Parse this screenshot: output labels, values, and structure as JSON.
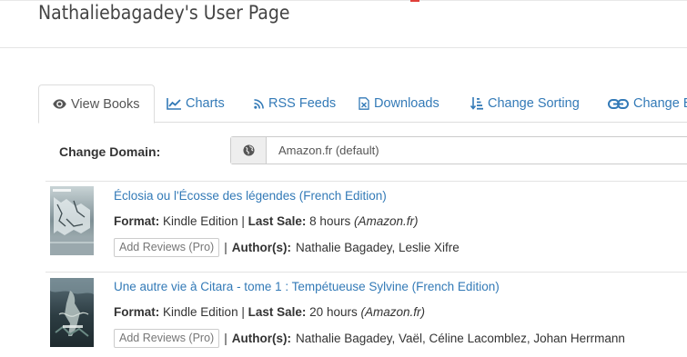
{
  "page": {
    "title": "Nathaliebagadey's User Page"
  },
  "tabs": [
    {
      "label": "View Books",
      "icon": "eye-icon",
      "active": true
    },
    {
      "label": "Charts",
      "icon": "line-chart-icon",
      "active": false
    },
    {
      "label": "RSS Feeds",
      "icon": "rss-icon",
      "active": false
    },
    {
      "label": "Downloads",
      "icon": "file-excel-icon",
      "active": false
    },
    {
      "label": "Change Sorting",
      "icon": "sort-amount-icon",
      "active": false
    },
    {
      "label": "Change E",
      "icon": "link-icon",
      "active": false
    }
  ],
  "domain": {
    "label": "Change Domain:",
    "icon": "globe-icon",
    "selected": "Amazon.fr (default)"
  },
  "labels": {
    "format": "Format:",
    "last_sale": "Last Sale:",
    "authors": "Author(s):",
    "add_reviews": "Add Reviews (Pro)",
    "sep": "|"
  },
  "books": [
    {
      "title": "Éclosia ou l'Écosse des légendes (French Edition)",
      "format": "Kindle Edition",
      "last_sale": "8 hours",
      "store": "(Amazon.fr)",
      "authors": "Nathalie Bagadey, Leslie Xifre"
    },
    {
      "title": "Une autre vie à Citara - tome 1 : Tempétueuse Sylvine (French Edition)",
      "format": "Kindle Edition",
      "last_sale": "20 hours",
      "store": "(Amazon.fr)",
      "authors": "Nathalie Bagadey, Vaël, Céline Lacomblez, Johan Herrmann"
    }
  ],
  "colors": {
    "link": "#337ab7",
    "accent_red": "#e0403a",
    "border": "#dddddd"
  }
}
